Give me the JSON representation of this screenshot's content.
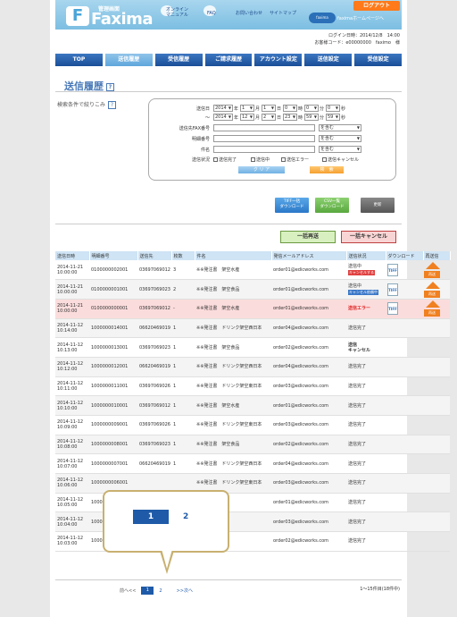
{
  "header": {
    "logo_small": "管理画面",
    "logo_text": "Faxima",
    "manual_label": "オンライン\nマニュアル",
    "faq_label": "FAQ",
    "contact_label": "お問い合わせ",
    "sitemap_label": "サイトマップ",
    "badge_label": "faxima",
    "home_label": "faximaホームページへ",
    "logout_label": "ログアウト",
    "login_time": "ログイン日時：2014/12/8　14:00",
    "customer": "お客様コード：e00000000　faximo　様"
  },
  "nav": [
    "TOP",
    "送信履歴",
    "受信履歴",
    "ご請求履歴",
    "アカウント設定",
    "送信設定",
    "受信設定"
  ],
  "nav_active": 1,
  "page_title": "送信履歴",
  "filter_label": "検索条件で絞りこみ",
  "search": {
    "date_label": "送信日",
    "from": {
      "year": "2014",
      "month": "1",
      "day": "1",
      "hour": "0",
      "min": "0",
      "sec": "0"
    },
    "tilde": "〜",
    "to": {
      "year": "2014",
      "month": "12",
      "day": "2",
      "hour": "23",
      "min": "59",
      "sec": "59"
    },
    "u_year": "年",
    "u_month": "月",
    "u_day": "日",
    "u_hour": "時",
    "u_min": "分",
    "u_sec": "秒",
    "fax_label": "送信先FAX番号",
    "detail_label": "明細番号",
    "subject_label": "件名",
    "match": "を含む",
    "status_label": "送信状況",
    "statuses": [
      "送信完了",
      "送信中",
      "送信エラー",
      "送信キャンセル"
    ],
    "clear_label": "ク リ ア",
    "search_label": "検　索"
  },
  "actions": {
    "tiff_label": "TIFF一括\nダウンロード",
    "csv_label": "CSV一覧\nダウンロード",
    "update_label": "更新",
    "bulk_resend": "一括再送",
    "bulk_cancel": "一括キャンセル"
  },
  "table": {
    "headers": [
      "送信日時",
      "明細番号",
      "送信先",
      "枚数",
      "件名",
      "発信メールアドレス",
      "送信状況",
      "ダウンロード",
      "再送信"
    ],
    "rows": [
      {
        "date": "2014-11-21",
        "time": "10:00:00",
        "id": "0100000002001",
        "to": "03697069012",
        "pages": "3",
        "subject": "※※発注書　架空水産",
        "mail": "order01@edicworks.com",
        "status": "送信中",
        "btn": "キャンセルする",
        "btn_type": "red",
        "tiff": true,
        "resend": true
      },
      {
        "date": "2014-11-21",
        "time": "10:00:00",
        "id": "0100000001001",
        "to": "03697069023",
        "pages": "2",
        "subject": "※※発注書　架空食品",
        "mail": "order01@edicworks.com",
        "status": "送信中",
        "btn": "キャンセル依頼中",
        "btn_type": "blue",
        "tiff": true,
        "resend": true
      },
      {
        "date": "2014-11-21",
        "time": "10:00:00",
        "id": "0100000000001",
        "to": "03697069012",
        "pages": "-",
        "subject": "※※発注書　架空水産",
        "mail": "order01@edicworks.com",
        "status": "送信エラー",
        "err": true,
        "tiff": true,
        "resend": true
      },
      {
        "date": "2014-11-12",
        "time": "10:14:00",
        "id": "1000000014001",
        "to": "06620469019",
        "pages": "1",
        "subject": "※※発注書　ドリンク架空西日本",
        "mail": "order04@edicworks.com",
        "status": "送信完了"
      },
      {
        "date": "2014-11-12",
        "time": "10:13:00",
        "id": "1000000013001",
        "to": "03697069023",
        "pages": "1",
        "subject": "※※発注書　架空食品",
        "mail": "order02@edicworks.com",
        "status": "送信\nキャンセル",
        "bold": true
      },
      {
        "date": "2014-11-12",
        "time": "10:12:00",
        "id": "1000000012001",
        "to": "06620469019",
        "pages": "1",
        "subject": "※※発注書　ドリンク架空西日本",
        "mail": "order04@edicworks.com",
        "status": "送信完了"
      },
      {
        "date": "2014-11-12",
        "time": "10:11:00",
        "id": "1000000011001",
        "to": "03697069026",
        "pages": "1",
        "subject": "※※発注書　ドリンク架空東日本",
        "mail": "order03@edicworks.com",
        "status": "送信完了"
      },
      {
        "date": "2014-11-12",
        "time": "10:10:00",
        "id": "1000000010001",
        "to": "03697069012",
        "pages": "1",
        "subject": "※※発注書　架空水産",
        "mail": "order01@edicworks.com",
        "status": "送信完了"
      },
      {
        "date": "2014-11-12",
        "time": "10:09:00",
        "id": "1000000009001",
        "to": "03697069026",
        "pages": "1",
        "subject": "※※発注書　ドリンク架空東日本",
        "mail": "order03@edicworks.com",
        "status": "送信完了"
      },
      {
        "date": "2014-11-12",
        "time": "10:08:00",
        "id": "1000000008001",
        "to": "03697069023",
        "pages": "1",
        "subject": "※※発注書　架空食品",
        "mail": "order02@edicworks.com",
        "status": "送信完了"
      },
      {
        "date": "2014-11-12",
        "time": "10:07:00",
        "id": "1000000007001",
        "to": "06620469019",
        "pages": "1",
        "subject": "※※発注書　ドリンク架空西日本",
        "mail": "order04@edicworks.com",
        "status": "送信完了"
      },
      {
        "date": "2014-11-12",
        "time": "10:06:00",
        "id": "1000000006001",
        "to": "",
        "pages": "",
        "subject": "※※発注書　ドリンク架空東日本",
        "mail": "order03@edicworks.com",
        "status": "送信完了"
      },
      {
        "date": "2014-11-12",
        "time": "10:05:00",
        "id": "1000000005001",
        "to": "",
        "pages": "",
        "subject": "",
        "mail": "order01@edicworks.com",
        "status": "送信完了"
      },
      {
        "date": "2014-11-12",
        "time": "10:04:00",
        "id": "1000000004001",
        "to": "",
        "pages": "",
        "subject": "本",
        "mail": "order03@edicworks.com",
        "status": "送信完了"
      },
      {
        "date": "2014-11-12",
        "time": "10:03:00",
        "id": "1000000003001",
        "to": "",
        "pages": "",
        "subject": "",
        "mail": "order02@edicworks.com",
        "status": "送信完了"
      }
    ]
  },
  "pager": {
    "prev": "前へ<<",
    "current": "1",
    "next_page": "2",
    "next": ">>次へ",
    "total": "1〜15件目(18件中)"
  },
  "callout": {
    "page1": "1",
    "page2": "2"
  },
  "icons": {
    "tiff": "TIFF",
    "resend": "再送"
  }
}
